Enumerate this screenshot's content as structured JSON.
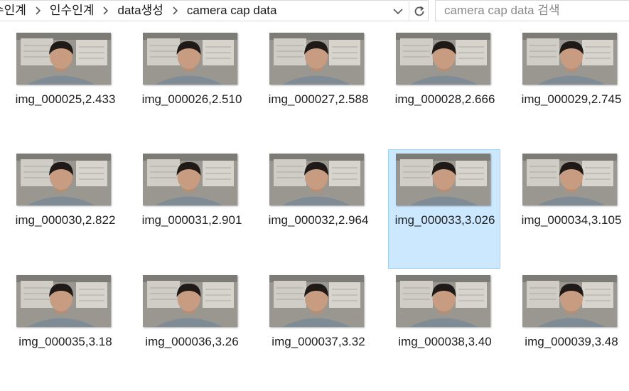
{
  "breadcrumbs": [
    "수인계",
    "인수인계",
    "data생성",
    "camera cap data"
  ],
  "search": {
    "placeholder": "camera cap data 검색"
  },
  "files": [
    {
      "name": "img_000025,2.433"
    },
    {
      "name": "img_000026,2.510"
    },
    {
      "name": "img_000027,2.588"
    },
    {
      "name": "img_000028,2.666"
    },
    {
      "name": "img_000029,2.745"
    },
    {
      "name": "img_000030,2.822"
    },
    {
      "name": "img_000031,2.901"
    },
    {
      "name": "img_000032,2.964"
    },
    {
      "name": "img_000033,3.026",
      "selected": true
    },
    {
      "name": "img_000034,3.105"
    },
    {
      "name": "img_000035,3.18"
    },
    {
      "name": "img_000036,3.26"
    },
    {
      "name": "img_000037,3.32"
    },
    {
      "name": "img_000038,3.40"
    },
    {
      "name": "img_000039,3.48"
    }
  ],
  "colors": {
    "selection_fill": "#cce8ff",
    "selection_border": "#99d1ff"
  },
  "icons": {
    "separator": "chevron-right-icon",
    "dropdown": "chevron-down-icon",
    "refresh": "refresh-icon"
  }
}
